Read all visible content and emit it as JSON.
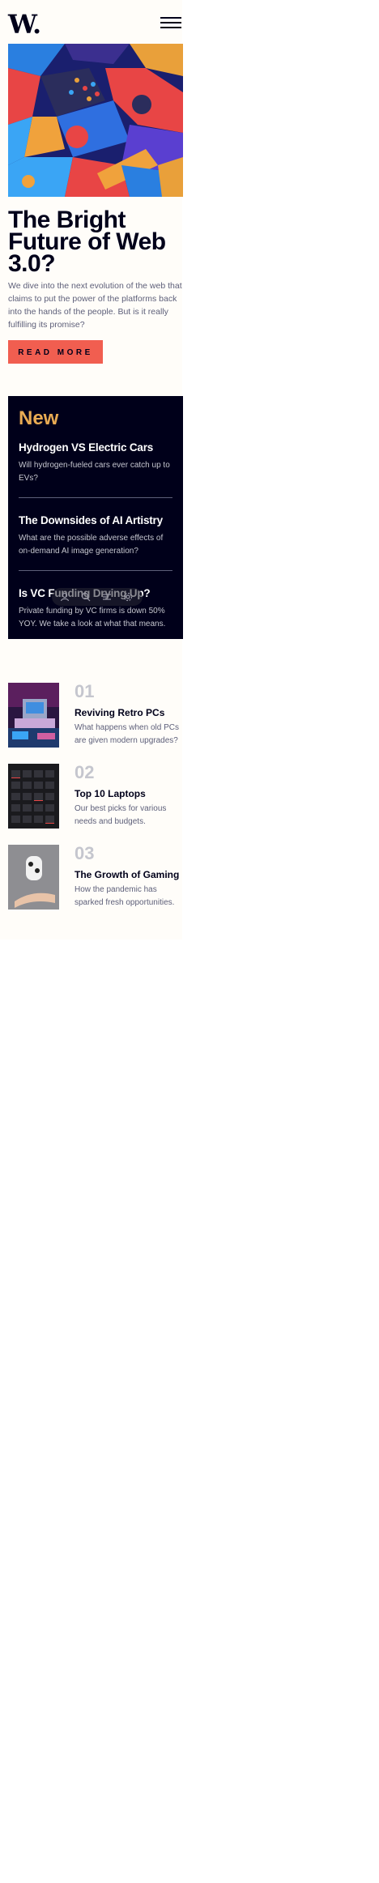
{
  "header": {
    "logo_text": "W.",
    "menu_icon": "hamburger-menu-icon"
  },
  "hero": {
    "image_icon": "abstract-3d-blocks-image",
    "title": "The Bright Future of Web 3.0?",
    "description": "We dive into the next evolution of the web that claims to put the power of the platforms back into the hands of the people. But is it really fulfilling its promise?",
    "button_label": "READ MORE"
  },
  "new_section": {
    "heading": "New",
    "items": [
      {
        "title": "Hydrogen VS Electric Cars",
        "description": "Will hydrogen-fueled cars ever catch up to EVs?"
      },
      {
        "title": "The Downsides of AI Artistry",
        "description": "What are the possible adverse effects of on-demand AI image generation?"
      },
      {
        "title": "Is VC Funding Drying Up?",
        "description": "Private funding by VC firms is down 50% YOY. We take a look at what that means."
      }
    ]
  },
  "list": {
    "items": [
      {
        "number": "01",
        "title": "Reviving Retro PCs",
        "description": "What happens when old PCs are given modern upgrades?",
        "image_icon": "retro-pc-image"
      },
      {
        "number": "02",
        "title": "Top 10 Laptops",
        "description": "Our best picks for various needs and budgets.",
        "image_icon": "laptop-keyboard-image"
      },
      {
        "number": "03",
        "title": "The Growth of Gaming",
        "description": "How the pandemic has sparked fresh opportunities.",
        "image_icon": "gamepad-image"
      }
    ]
  },
  "toolbar": {
    "icons": [
      "user-icon",
      "search-icon",
      "list-icon",
      "settings-icon"
    ]
  },
  "colors": {
    "dark_navy": "#00001a",
    "accent_red": "#f15e50",
    "accent_orange": "#e9ab53",
    "background": "#fffdf9",
    "grayish_blue": "#5d5f79",
    "light_gray": "#c5c6ce"
  }
}
